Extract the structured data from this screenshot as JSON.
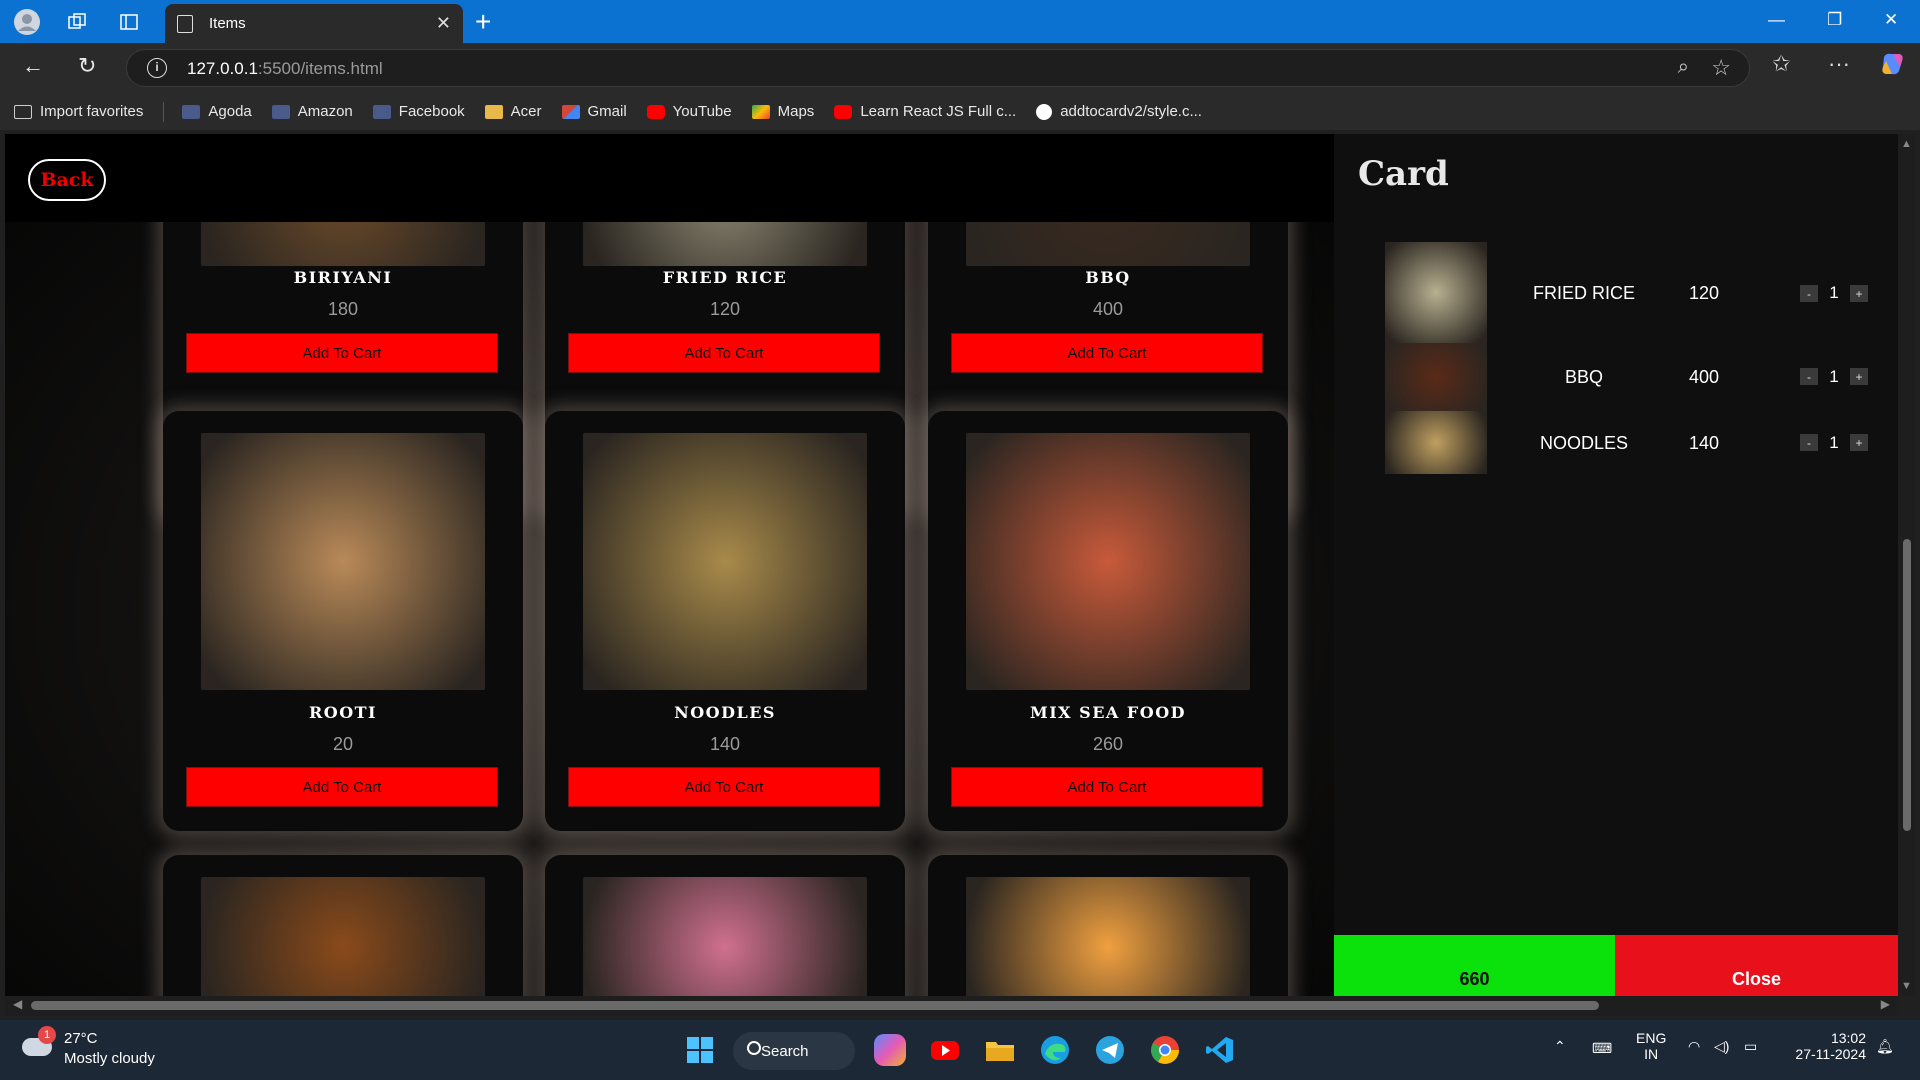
{
  "browser": {
    "tab_title": "Items",
    "url_host": "127.0.0.1",
    "url_path": ":5500/items.html",
    "favorites": [
      {
        "label": "Import favorites",
        "icon": "import-icon",
        "color": "#cccccc"
      },
      {
        "label": "Agoda",
        "icon": "page-icon",
        "color": "#4a5a8a"
      },
      {
        "label": "Amazon",
        "icon": "page-icon",
        "color": "#4a5a8a"
      },
      {
        "label": "Facebook",
        "icon": "page-icon",
        "color": "#4a5a8a"
      },
      {
        "label": "Acer",
        "icon": "folder-icon",
        "color": "#e8b84a"
      },
      {
        "label": "Gmail",
        "icon": "gmail-icon",
        "color": "#d44638"
      },
      {
        "label": "YouTube",
        "icon": "youtube-icon",
        "color": "#ff0000"
      },
      {
        "label": "Maps",
        "icon": "maps-icon",
        "color": "#34a853"
      },
      {
        "label": "Learn React JS Full c...",
        "icon": "youtube-icon",
        "color": "#ff0000"
      },
      {
        "label": "addtocardv2/style.c...",
        "icon": "github-icon",
        "color": "#ffffff"
      }
    ]
  },
  "page": {
    "back_label": "Back",
    "add_label": "Add To Cart",
    "items": [
      {
        "name": "BIRIYANI",
        "price": "180",
        "image": "biriyani-image",
        "color": "#6b4a2a"
      },
      {
        "name": "FRIED RICE",
        "price": "120",
        "image": "fried-rice-image",
        "color": "#8a8570"
      },
      {
        "name": "BBQ",
        "price": "400",
        "image": "bbq-image",
        "color": "#3a2a20"
      },
      {
        "name": "ROOTI",
        "price": "20",
        "image": "rooti-image",
        "color": "#b98a58"
      },
      {
        "name": "NOODLES",
        "price": "140",
        "image": "noodles-image",
        "color": "#a88a4a"
      },
      {
        "name": "MIX SEA FOOD",
        "price": "260",
        "image": "seafood-image",
        "color": "#c85a3a"
      },
      {
        "name": "",
        "price": "",
        "image": "chicken-curry-image",
        "color": "#8a4a1a"
      },
      {
        "name": "",
        "price": "",
        "image": "milkshake-image",
        "color": "#d07090"
      },
      {
        "name": "",
        "price": "",
        "image": "juice-image",
        "color": "#f0a040"
      }
    ]
  },
  "cart": {
    "title": "Card",
    "items": [
      {
        "name": "FRIED RICE",
        "price": "120",
        "qty": "1",
        "image": "fried-rice-thumb",
        "color": "#b8b090"
      },
      {
        "name": "BBQ",
        "price": "400",
        "qty": "1",
        "image": "bbq-thumb",
        "color": "#5a2a18"
      },
      {
        "name": "NOODLES",
        "price": "140",
        "qty": "1",
        "image": "noodles-thumb",
        "color": "#c0a060"
      }
    ],
    "minus_label": "-",
    "plus_label": "+",
    "total": "660",
    "close_label": "Close"
  },
  "taskbar": {
    "weather_badge": "1",
    "temperature": "27°C",
    "condition": "Mostly cloudy",
    "search_label": "Search",
    "lang_top": "ENG",
    "lang_bottom": "IN",
    "time": "13:02",
    "date": "27-11-2024"
  }
}
